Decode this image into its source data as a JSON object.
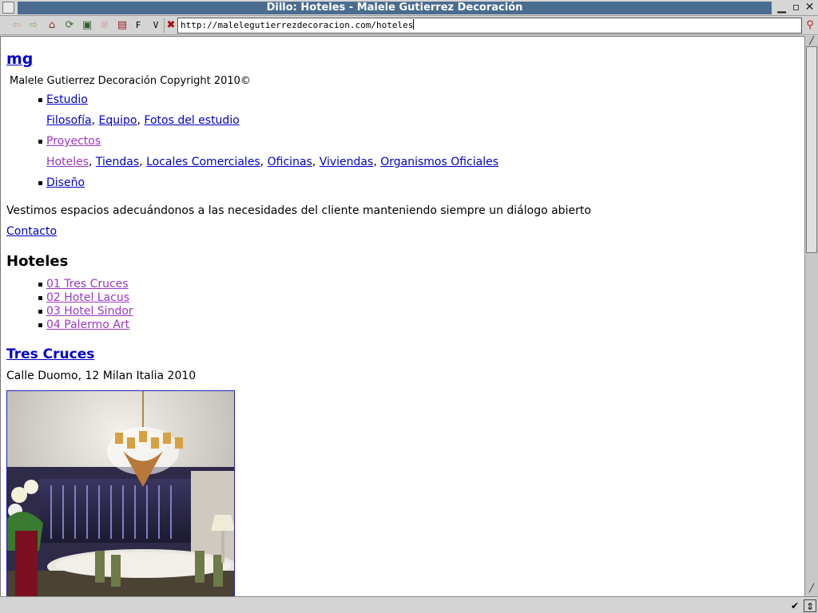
{
  "window": {
    "title": "Dillo: Hoteles - Malele Gutierrez Decoración"
  },
  "toolbar": {
    "url": "http://malelegutierrezdecoracion.com/hoteles",
    "f_label": "F",
    "v_label": "V"
  },
  "site": {
    "logo": "mg",
    "copyright": "Malele Gutierrez Decoración Copyright 2010©"
  },
  "nav": {
    "estudio": "Estudio",
    "estudio_sub": [
      "Filosofía",
      "Equipo",
      "Fotos del estudio"
    ],
    "proyectos": "Proyectos",
    "proyectos_sub": [
      "Hoteles",
      "Tiendas",
      "Locales Comerciales",
      "Oficinas",
      "Viviendas",
      "Organismos Oficiales"
    ],
    "diseno": "Diseño",
    "separator": ","
  },
  "tagline": "Vestimos espacios adecuándonos a las necesidades del cliente manteniendo siempre un diálogo abierto",
  "contact": "Contacto",
  "section": {
    "title": "Hoteles",
    "items": [
      "01 Tres Cruces",
      "02 Hotel Lacus",
      "03 Hotel Sindor",
      "04 Palermo Art"
    ]
  },
  "hotel": {
    "title": "Tres Cruces",
    "address": "Calle Duomo, 12 Milan Italia 2010"
  },
  "colors": {
    "link": "#0000c8",
    "visited": "#9b36c4",
    "titlebar": "#4a6c8e"
  }
}
